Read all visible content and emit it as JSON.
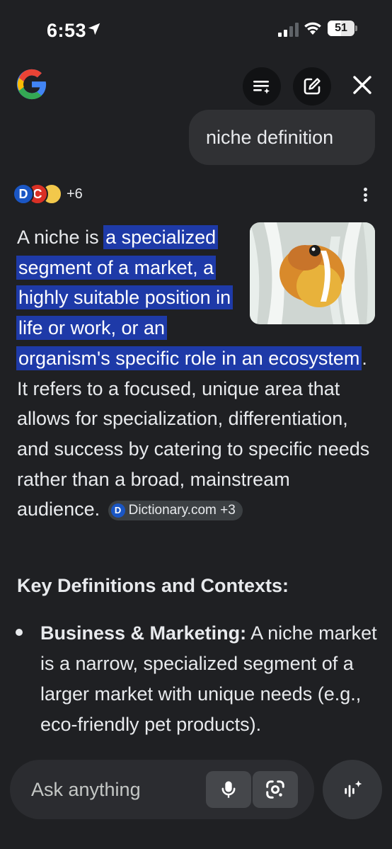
{
  "status_bar": {
    "time": "6:53",
    "battery": "51",
    "battery_level": 0.51
  },
  "header": {
    "logo_icon": "google-g-icon",
    "buttons": [
      {
        "name": "history-list-icon"
      },
      {
        "name": "new-chat-edit-icon"
      },
      {
        "name": "close-icon"
      }
    ]
  },
  "query": {
    "text": "niche definition"
  },
  "sources": {
    "icons": [
      "D",
      "C",
      ""
    ],
    "more": "+6"
  },
  "answer": {
    "intro": "A niche is ",
    "highlight": "a specialized segment of a market, a highly suitable position in life or work, or an organism's specific role in an ecosystem",
    "rest": ". It refers to a focused, unique area that allows for specialization, differentiation, and success by catering to specific needs rather than a broad, mainstream audience. ",
    "citation": {
      "label": "Dictionary.com +3",
      "icon_letter": "D"
    },
    "image_alt": "clownfish in sea anemone"
  },
  "section": {
    "heading": "Key Definitions and Contexts:"
  },
  "bullets": [
    {
      "title": "Business & Marketing:",
      "text": " A niche market is a narrow, specialized segment of a larger market with unique needs (e.g., eco-friendly pet products)."
    }
  ],
  "ask_bar": {
    "placeholder": "Ask anything"
  },
  "colors": {
    "background": "#1f2023",
    "highlight": "#1e3aa8",
    "bubble": "#303134"
  }
}
